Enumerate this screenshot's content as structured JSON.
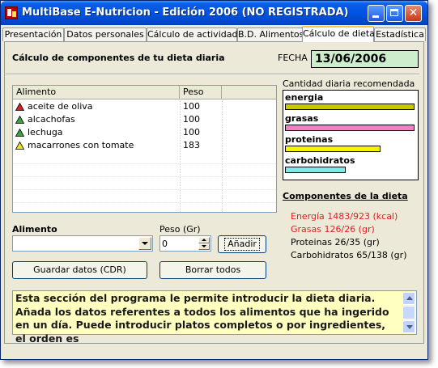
{
  "window": {
    "title": "MultiBase E-Nutricion - Edición 2006 (NO REGISTRADA)",
    "close_glyph": "✕"
  },
  "tabs": [
    {
      "label": "Presentación",
      "active": false
    },
    {
      "label": "Datos personales",
      "active": false
    },
    {
      "label": "Cálculo de actividad",
      "active": false
    },
    {
      "label": "B.D. Alimentos",
      "active": false
    },
    {
      "label": "Cálculo de dieta",
      "active": true
    },
    {
      "label": "Estadística",
      "active": false
    }
  ],
  "header": {
    "section_title": "Cálculo de componentes de tu dieta diaria",
    "fecha_label": "FECHA",
    "fecha_value": "13/06/2006"
  },
  "food_list": {
    "columns": [
      "Alimento",
      "Peso"
    ],
    "rows": [
      {
        "alimento": "aceite de oliva",
        "peso": "100",
        "icon": "red-triangle-icon",
        "color": "#e02020"
      },
      {
        "alimento": "alcachofas",
        "peso": "100",
        "icon": "green-triangle-icon",
        "color": "#3aa63a"
      },
      {
        "alimento": "lechuga",
        "peso": "100",
        "icon": "green-triangle-icon",
        "color": "#3aa63a"
      },
      {
        "alimento": "macarrones con tomate",
        "peso": "183",
        "icon": "yellow-triangle-icon",
        "color": "#f2e21a"
      }
    ]
  },
  "form": {
    "alimento_label": "Alimento",
    "alimento_value": "",
    "peso_label": "Peso (Gr)",
    "peso_value": "0",
    "add_button": "Añadir",
    "save_button": "Guardar datos (CDR)",
    "clear_button": "Borrar todos"
  },
  "cdr": {
    "title": "Cantidad diaria recomendada",
    "items": [
      {
        "label": "energia",
        "fraction": 1.0,
        "color": "#c8c800"
      },
      {
        "label": "grasas",
        "fraction": 1.0,
        "color": "#f080c8"
      },
      {
        "label": "proteinas",
        "fraction": 0.74,
        "color": "#f5f500"
      },
      {
        "label": "carbohidratos",
        "fraction": 0.47,
        "color": "#80e8e8"
      }
    ]
  },
  "componentes": {
    "title": "Componentes de la dieta",
    "lines": [
      {
        "text": "Energía 1483/923 (kcal)",
        "color": "#e02020"
      },
      {
        "text": "Grasas 126/26 (gr)",
        "color": "#e02020"
      },
      {
        "text": "Proteinas 26/35 (gr)",
        "color": "#000000"
      },
      {
        "text": "Carbohidratos 65/138 (gr)",
        "color": "#000000"
      }
    ]
  },
  "message": {
    "text": "Esta sección del programa le permite introducir la dieta diaria. Añada los datos referentes a todos los alimentos que ha ingerido en un día. Puede introducir platos completos o por ingredientes, el orden es"
  }
}
